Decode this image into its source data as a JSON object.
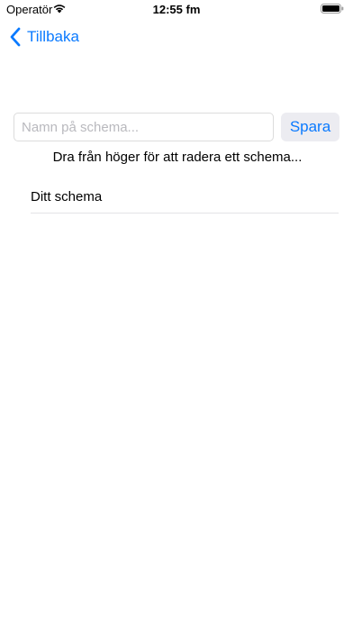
{
  "status_bar": {
    "carrier": "Operatör",
    "time": "12:55 fm"
  },
  "nav": {
    "back_label": "Tillbaka"
  },
  "schedule_form": {
    "name_value": "",
    "name_placeholder": "Namn på schema...",
    "save_label": "Spara"
  },
  "hint": "Dra från höger för att radera ett schema...",
  "schedules": [
    {
      "label": "Ditt schema"
    }
  ],
  "colors": {
    "accent": "#0a7aff",
    "button_bg": "#ececf1",
    "separator": "#e3e3e6"
  }
}
